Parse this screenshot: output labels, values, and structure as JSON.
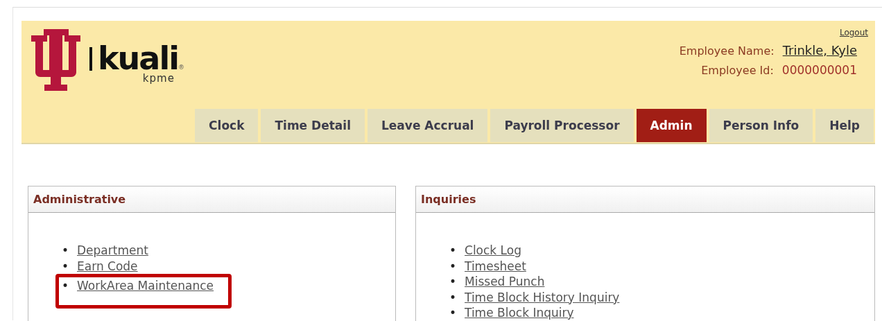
{
  "logo": {
    "wordmark": "kuali",
    "registered": "®",
    "product": "kpme"
  },
  "user": {
    "logout": "Logout",
    "name_label": "Employee Name:",
    "name": "Trinkle, Kyle",
    "id_label": "Employee Id:",
    "id": "0000000001"
  },
  "tabs": [
    {
      "label": "Clock",
      "selected": false
    },
    {
      "label": "Time Detail",
      "selected": false
    },
    {
      "label": "Leave Accrual",
      "selected": false
    },
    {
      "label": "Payroll Processor",
      "selected": false
    },
    {
      "label": "Admin",
      "selected": true
    },
    {
      "label": "Person Info",
      "selected": false
    },
    {
      "label": "Help",
      "selected": false
    }
  ],
  "panels": [
    {
      "title": "Administrative",
      "bullet": "•",
      "links": [
        {
          "label": "Department",
          "highlighted": false
        },
        {
          "label": "Earn Code",
          "highlighted": false
        },
        {
          "label": "WorkArea Maintenance",
          "highlighted": true
        }
      ]
    },
    {
      "title": "Inquiries",
      "bullet": "•",
      "links": [
        {
          "label": "Clock Log",
          "highlighted": false
        },
        {
          "label": "Timesheet",
          "highlighted": false
        },
        {
          "label": "Missed Punch",
          "highlighted": false
        },
        {
          "label": "Time Block History Inquiry",
          "highlighted": false
        },
        {
          "label": "Time Block Inquiry",
          "highlighted": false
        }
      ]
    }
  ]
}
